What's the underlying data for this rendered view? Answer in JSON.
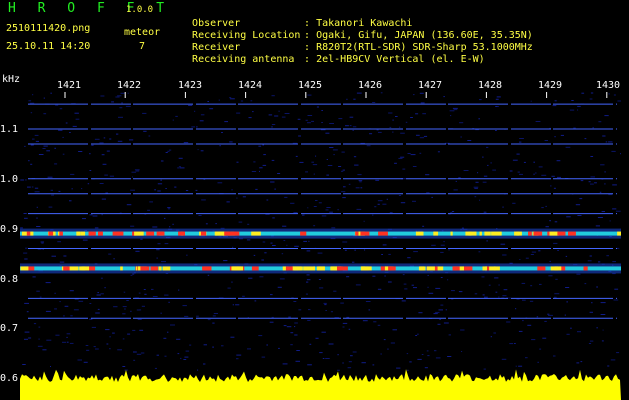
{
  "header": {
    "app_title": "H R O F F T",
    "app_version": "1.0.0",
    "file_name": "2510111420.png",
    "date_time": "25.10.11 14:20",
    "meteor_label": "meteor",
    "meteor_count": "7"
  },
  "meta": [
    {
      "key": "Observer",
      "value": ": Takanori Kawachi"
    },
    {
      "key": "Receiving Location",
      "value": ": Ogaki, Gifu, JAPAN (136.60E, 35.35N)"
    },
    {
      "key": "Receiver",
      "value": ": R820T2(RTL-SDR) SDR-Sharp 53.1000MHz"
    },
    {
      "key": "Receiving antenna",
      "value": ": 2el-HB9CV Vertical (el. E-W)"
    }
  ],
  "axes": {
    "y_unit": "kHz",
    "y_ticks": [
      "1.1",
      "1.0",
      "0.9",
      "0.8",
      "0.7",
      "0.6"
    ],
    "x_ticks": [
      "1421",
      "1422",
      "1423",
      "1424",
      "1425",
      "1426",
      "1427",
      "1428",
      "1429",
      "1430"
    ]
  },
  "colors": {
    "background": "#000000",
    "accent_title": "#22ee22",
    "text_yellow": "#ffff44",
    "signal_band": "#ff3322",
    "noise_line": "#2233cc",
    "power_trace": "#ffff00"
  },
  "spectrogram": {
    "carrier_freqs_khz": [
      0.89,
      0.82
    ],
    "spur_freqs_khz": [
      1.15,
      1.1,
      1.07,
      1.0,
      0.97,
      0.93,
      0.86,
      0.76,
      0.72
    ],
    "y_range_khz": [
      0.6,
      1.2
    ],
    "x_range_min": [
      1420.7,
      1430.2
    ]
  }
}
